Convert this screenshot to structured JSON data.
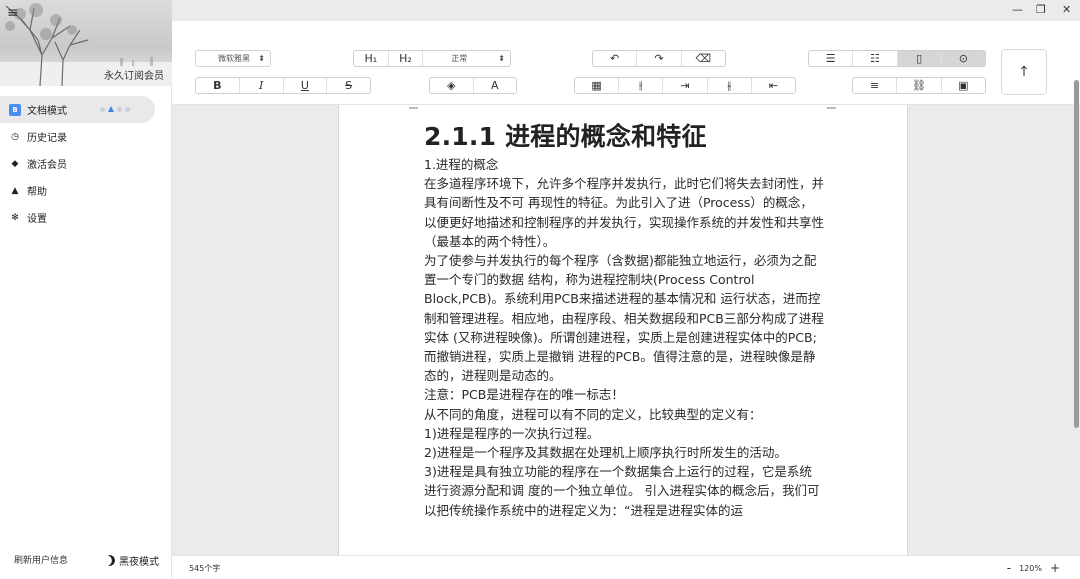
{
  "window": {
    "controls": [
      "—",
      "❐",
      "✕"
    ]
  },
  "sidebar": {
    "menu_icon": "≡",
    "banner_text": "永久订阅会员",
    "items": [
      {
        "label": "文档模式",
        "icon": "doc-icon",
        "glyph": "B",
        "active": true
      },
      {
        "label": "历史记录",
        "icon": "clock-icon",
        "glyph": "◷"
      },
      {
        "label": "激活会员",
        "icon": "diamond-icon",
        "glyph": "◆"
      },
      {
        "label": "帮助",
        "icon": "warning-icon",
        "glyph": "▲"
      },
      {
        "label": "设置",
        "icon": "gear-icon",
        "glyph": "✻"
      }
    ],
    "footer_left": "刷新用户信息",
    "footer_right": "黑夜模式"
  },
  "toolbar": {
    "font_select": "微软雅黑",
    "h1": "H₁",
    "h2": "H₂",
    "style_select": "正常",
    "bold": "B",
    "italic": "I",
    "underline": "U",
    "strike": "S",
    "fill": "◈",
    "text_color": "A",
    "undo": "↶",
    "redo": "↷",
    "eraser": "⌫",
    "table": "▦",
    "col_insert": "⫲",
    "indent": "⇥",
    "col_split": "⫳",
    "outdent": "⇤",
    "ordered_list": "☰",
    "bullet_list": "☷",
    "page_icon": "▯",
    "arrow_icon": "⊙",
    "align": "≡",
    "link": "⛓",
    "image": "▣",
    "scroll_top": "↑"
  },
  "document": {
    "title": "2.1.1 进程的概念和特征",
    "paragraphs": [
      "1.进程的概念",
      "在多道程序环境下，允许多个程序并发执行，此时它们将失去封闭性，并具有间断性及不可 再现性的特征。为此引入了进（Process）的概念，以便更好地描述和控制程序的并发执行，实现操作系统的并发性和共享性（最基本的两个特性）。",
      "为了使参与并发执行的每个程序（含数据)都能独立地运行，必须为之配置一个专门的数据 结构，称为进程控制块(Process Control Block,PCB)。系统利用PCB来描述进程的基本情况和 运行状态，进而控制和管理进程。相应地，由程序段、相关数据段和PCB三部分构成了进程实体 (又称进程映像)。所谓创建进程，实质上是创建进程实体中的PCB;而撤销进程，实质上是撤销 进程的PCB。值得注意的是，进程映像是静态的，进程则是动态的。",
      "注意：PCB是进程存在的唯一标志！",
      " 从不同的角度，进程可以有不同的定义，比较典型的定义有：",
      " 1)进程是程序的一次执行过程。",
      " 2)进程是一个程序及其数据在处理机上顺序执行时所发生的活动。",
      "3)进程是具有独立功能的程序在一个数据集合上运行的过程，它是系统进行资源分配和调 度的一个独立单位。 引入进程实体的概念后，我们可以把传统操作系统中的进程定义为：“进程是进程实体的运"
    ]
  },
  "status": {
    "word_count": "545个字",
    "zoom_minus": "-",
    "zoom_level": "120%",
    "zoom_plus": "+"
  }
}
